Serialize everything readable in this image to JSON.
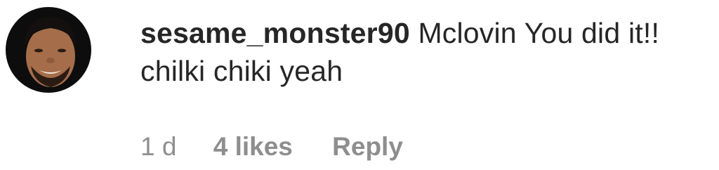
{
  "comment": {
    "username": "sesame_monster90",
    "text": "Mclovin You did it!! chilki chiki yeah",
    "time": "1 d",
    "likes": "4 likes",
    "reply_label": "Reply"
  }
}
